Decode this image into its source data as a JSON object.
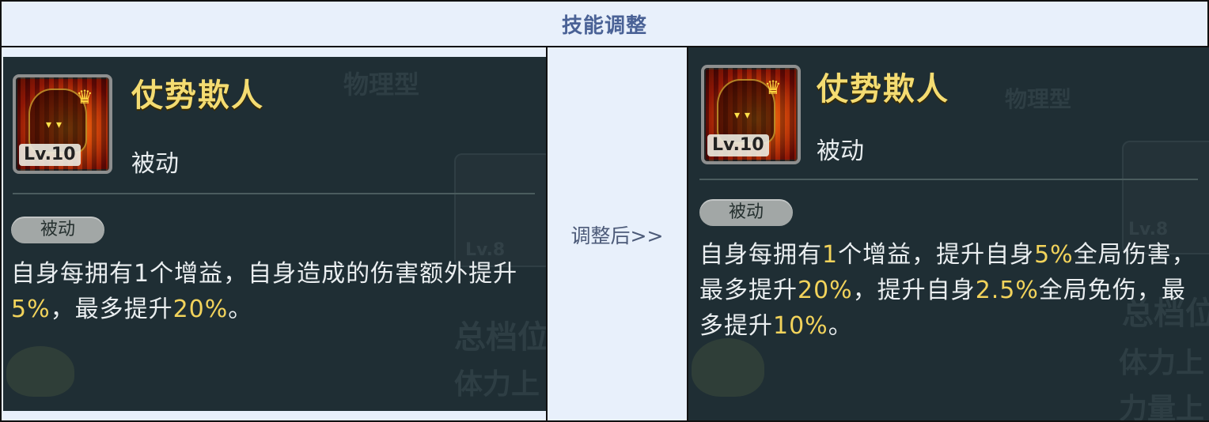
{
  "header": {
    "title": "技能调整"
  },
  "middle": {
    "label": "调整后>>"
  },
  "before": {
    "icon_level": "Lv.10",
    "name": "仗势欺人",
    "type": "被动",
    "badge": "被动",
    "desc": [
      {
        "t": "自身每拥有1个增益，自身造成的伤害"
      },
      {
        "t": "额外提升"
      },
      {
        "h": "5%"
      },
      {
        "t": "，最多提升"
      },
      {
        "h": "20%"
      },
      {
        "t": "。"
      }
    ]
  },
  "after": {
    "icon_level": "Lv.10",
    "name": "仗势欺人",
    "type": "被动",
    "badge": "被动",
    "desc": [
      {
        "t": "自身每拥有"
      },
      {
        "h": "1"
      },
      {
        "t": "个增益，提升自身"
      },
      {
        "h": "5%"
      },
      {
        "t": "全局"
      },
      {
        "t": "伤害，最多提升"
      },
      {
        "h": "20%"
      },
      {
        "t": "，提升自身"
      },
      {
        "h": "2.5%"
      },
      {
        "t": "全"
      },
      {
        "t": "局免伤，最多提升"
      },
      {
        "h": "10%"
      },
      {
        "t": "。"
      }
    ]
  },
  "colors": {
    "header_text": "#4a6296",
    "panel_bg": "#1f2e34",
    "title_gold": "#f4dc72",
    "highlight": "#f2d35b"
  },
  "icons": [
    "skill-icon-fire-crown"
  ],
  "background_ghost": {
    "left": [
      "物理型",
      "总档位",
      "体力上",
      "Lv.8"
    ],
    "right": [
      "物理型",
      "总档位",
      "体力上",
      "力量上",
      "Lv.8"
    ]
  }
}
